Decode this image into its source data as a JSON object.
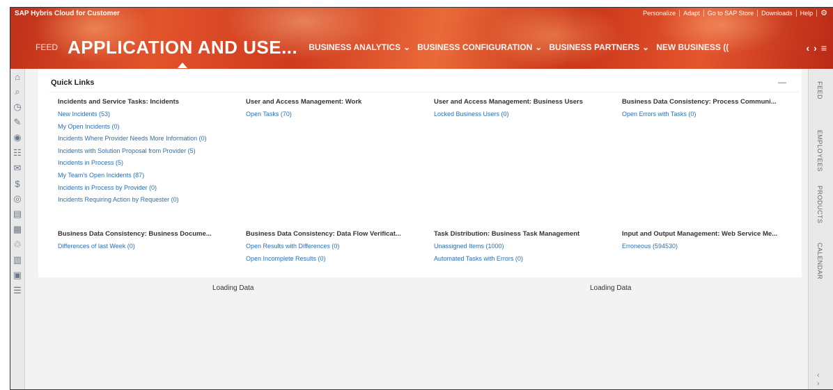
{
  "app": {
    "brand": "SAP Hybris Cloud for Customer",
    "toplinks": [
      "Personalize",
      "Adapt",
      "Go to SAP Store",
      "Downloads",
      "Help"
    ],
    "tabs": {
      "feed": "FEED",
      "active": "APPLICATION AND USE...",
      "others": [
        "BUSINESS ANALYTICS",
        "BUSINESS CONFIGURATION",
        "BUSINESS PARTNERS",
        "NEW BUSINESS (("
      ]
    }
  },
  "rightbar": [
    "FEED",
    "EMPLOYEES",
    "PRODUCTS",
    "CALENDAR"
  ],
  "quick_links": {
    "title": "Quick Links",
    "collapse": "—",
    "groups_row1": [
      {
        "title": "Incidents and Service Tasks: Incidents",
        "links": [
          "New Incidents (53)",
          "My Open Incidents (0)",
          "Incidents Where Provider Needs More Information (0)",
          "Incidents with Solution Proposal from Provider (5)",
          "Incidents in Process (5)",
          "My Team's Open Incidents (87)",
          "Incidents in Process by Provider (0)",
          "Incidents Requiring Action by Requester (0)"
        ]
      },
      {
        "title": "User and Access Management: Work",
        "links": [
          "Open Tasks (70)"
        ]
      },
      {
        "title": "User and Access Management: Business Users",
        "links": [
          "Locked Business Users (0)"
        ]
      },
      {
        "title": "Business Data Consistency: Process Communi...",
        "links": [
          "Open Errors with Tasks (0)"
        ]
      }
    ],
    "groups_row2": [
      {
        "title": "Business Data Consistency: Business Docume...",
        "links": [
          "Differences of last Week (0)"
        ]
      },
      {
        "title": "Business Data Consistency: Data Flow Verificat...",
        "links": [
          "Open Results with Differences (0)",
          "Open Incomplete Results (0)"
        ]
      },
      {
        "title": "Task Distribution: Business Task Management",
        "links": [
          "Unassigned Items (1000)",
          "Automated Tasks with Errors (0)"
        ]
      },
      {
        "title": "Input and Output Management: Web Service Me...",
        "links": [
          "Erroneous (594530)"
        ]
      }
    ]
  },
  "loading": [
    "Loading Data",
    "Loading Data"
  ]
}
